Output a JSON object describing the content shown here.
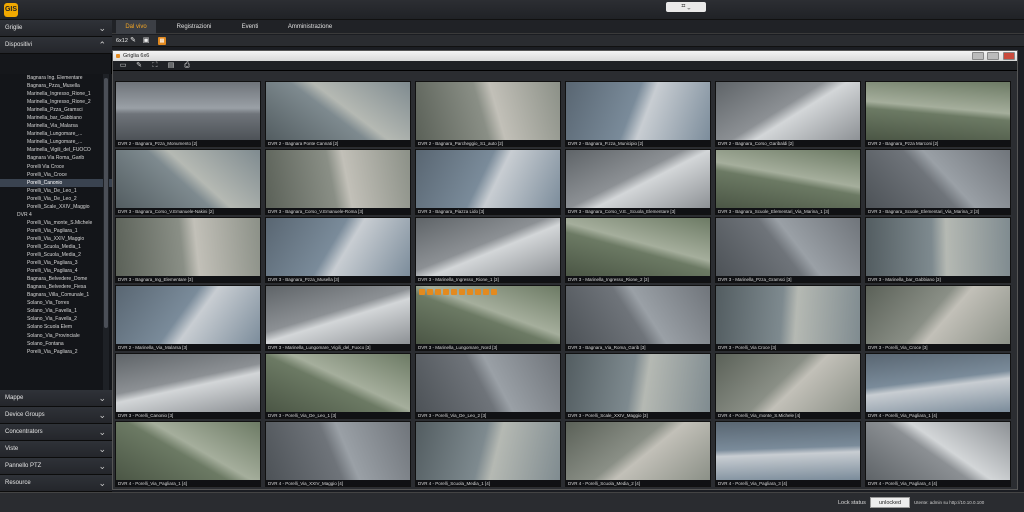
{
  "titlebar": {
    "logo_text": "GIS",
    "window_control": "⌗ ⌄"
  },
  "sidebar": {
    "sections": [
      {
        "id": "griglie",
        "label": "Griglie",
        "expanded": false
      },
      {
        "id": "dispositivi",
        "label": "Dispositivi",
        "expanded": true
      },
      {
        "id": "mappe",
        "label": "Mappe",
        "expanded": false
      },
      {
        "id": "device-groups",
        "label": "Device Groups",
        "expanded": false
      },
      {
        "id": "concentrators",
        "label": "Concentrators",
        "expanded": false
      },
      {
        "id": "viste",
        "label": "Viste",
        "expanded": false
      },
      {
        "id": "pannello-ptz",
        "label": "Pannello PTZ",
        "expanded": false
      },
      {
        "id": "resource",
        "label": "Resource",
        "expanded": false
      }
    ],
    "tree": [
      {
        "label": "Bagnara Ing. Elementare",
        "group": false
      },
      {
        "label": "Bagnara_Pzza_Musella",
        "group": false
      },
      {
        "label": "Marinella_Ingresso_Rione_1",
        "group": false
      },
      {
        "label": "Marinella_Ingresso_Rione_2",
        "group": false
      },
      {
        "label": "Marinella_Pzza_Gramsci",
        "group": false
      },
      {
        "label": "Marinella_bar_Gabbiano",
        "group": false
      },
      {
        "label": "Marinella_Via_Malarsa",
        "group": false
      },
      {
        "label": "Marinella_Lungomare_...",
        "group": false
      },
      {
        "label": "Marinella_Lungomare_...",
        "group": false
      },
      {
        "label": "Marinella_Vigili_del_FUOCO",
        "group": false
      },
      {
        "label": "Bagnara Via Roma_Garib",
        "group": false
      },
      {
        "label": "Porelli Via Croce",
        "group": false
      },
      {
        "label": "Porelli_Via_Croce",
        "group": false
      },
      {
        "label": "Porelli_Canonio",
        "group": false,
        "selected": true
      },
      {
        "label": "Porelli_Via_De_Leo_1",
        "group": false
      },
      {
        "label": "Porelli_Via_De_Leo_2",
        "group": false
      },
      {
        "label": "Porelli_Scale_XXIV_Maggio",
        "group": false
      },
      {
        "label": "DVR 4",
        "group": true
      },
      {
        "label": "Porelli_Via_monte_S.Michele",
        "group": false
      },
      {
        "label": "Porelli_Via_Pagliara_1",
        "group": false
      },
      {
        "label": "Porelli_Via_XXIV_Maggio",
        "group": false
      },
      {
        "label": "Porelli_Scuola_Media_1",
        "group": false
      },
      {
        "label": "Porelli_Scuola_Media_2",
        "group": false
      },
      {
        "label": "Porelli_Via_Pagliara_3",
        "group": false
      },
      {
        "label": "Porelli_Via_Pagliara_4",
        "group": false
      },
      {
        "label": "Bagnara_Belvedere_Dome",
        "group": false
      },
      {
        "label": "Bagnara_Belvedere_Fiesa",
        "group": false
      },
      {
        "label": "Bagnara_Villa_Comunale_1",
        "group": false
      },
      {
        "label": "Solano_Via_Torres",
        "group": false
      },
      {
        "label": "Solano_Via_Favella_1",
        "group": false
      },
      {
        "label": "Solano_Via_Favella_2",
        "group": false
      },
      {
        "label": "Solano Scuola Elem",
        "group": false
      },
      {
        "label": "Solano_Via_Provinciale",
        "group": false
      },
      {
        "label": "Solano_Fontana",
        "group": false
      },
      {
        "label": "Porelli_Via_Pagliara_2",
        "group": false
      }
    ]
  },
  "menubar": {
    "items": [
      {
        "label": "Dal vivo",
        "active": true
      },
      {
        "label": "Registrazioni",
        "active": false
      },
      {
        "label": "Eventi",
        "active": false
      },
      {
        "label": "Amministrazione",
        "active": false
      }
    ]
  },
  "toolbar2": {
    "label": "6x12"
  },
  "grid_window": {
    "title": "Griglia 6x6"
  },
  "cameras": [
    "DVR 2 - Bagnara_Pzza_Monumento [2]",
    "DVR 2 - Bagnara Ponte Cannati [2]",
    "DVR 2 - Bagnara_Parcheggio_S1_auto [2]",
    "DVR 2 - Bagnara_P.zza_Municipio [2]",
    "DVR 2 - Bagnara_Corso_Garibaldi [2]",
    "DVR 2 - Bagnara_Pzza Marconi [2]",
    "DVR 3 - Bagnara_Corso_V.Emanuele-Nakini [2]",
    "DVR 3 - Bagnara_Corso_V.Emanuele-Roma [3]",
    "DVR 3 - Bagnara_Piazza Lido [3]",
    "DVR 3 - Bagnara_Corso_V.E._Scuola_Elementare [3]",
    "DVR 3 - Bagnara_Scuole_Elementari_Via_Marina_1 [3]",
    "DVR 3 - Bagnara_Scuole_Elementari_Via_Marina_2 [3]",
    "DVR 3 - Bagnara_Ing_Elementare [3]",
    "DVR 3 - Bagnara_Pzza_Musella [3]",
    "DVR 3 - Marinella_Ingresso_Rione_1 [3]",
    "DVR 3 - Marinella_Ingresso_Rione_2 [3]",
    "DVR 3 - Marinella_Pzza_Gramsci [3]",
    "DVR 3 - Marinella_bar_Gabbiano [3]",
    "DVR 2 - Marinella_Via_Malarsa [3]",
    "DVR 3 - Marinella_Lungomare_Vigili_del_Fuoco [3]",
    "DVR 3 - Marinella_Lungomare_Nord [3]",
    "DVR 3 - Bagnara_Via_Roma_Garib [3]",
    "DVR 3 - Porelli_Via Croce [3]",
    "DVR 3 - Porelli_Via_Croce [3]",
    "DVR 3 - Porelli_Canonio [3]",
    "DVR 3 - Porelli_Via_De_Leo_1 [3]",
    "DVR 3 - Porelli_Via_De_Leo_2 [3]",
    "DVR 3 - Porelli_Scale_XXIV_Maggio [3]",
    "DVR 4 - Porelli_Via_monte_S.Michele [4]",
    "DVR 4 - Porelli_Via_Pagliara_1 [4]",
    "DVR 4 - Porelli_Via_Pagliara_1 [4]",
    "DVR 4 - Porelli_Via_XXIV_Maggio [4]",
    "DVR 4 - Porelli_Scuola_Media_1 [4]",
    "DVR 4 - Porelli_Scuola_Media_2 [4]",
    "DVR 4 - Porelli_Via_Pagliara_3 [4]",
    "DVR 4 - Porelli_Via_Pagliara_4 [4]"
  ],
  "status": {
    "lock_label": "Lock status",
    "lock_button": "unlocked",
    "user_info": "Utente: admin  su  http://10.10.0.100"
  },
  "colors": {
    "accent": "#e38a1f",
    "active_menu_text": "#f5a623"
  }
}
